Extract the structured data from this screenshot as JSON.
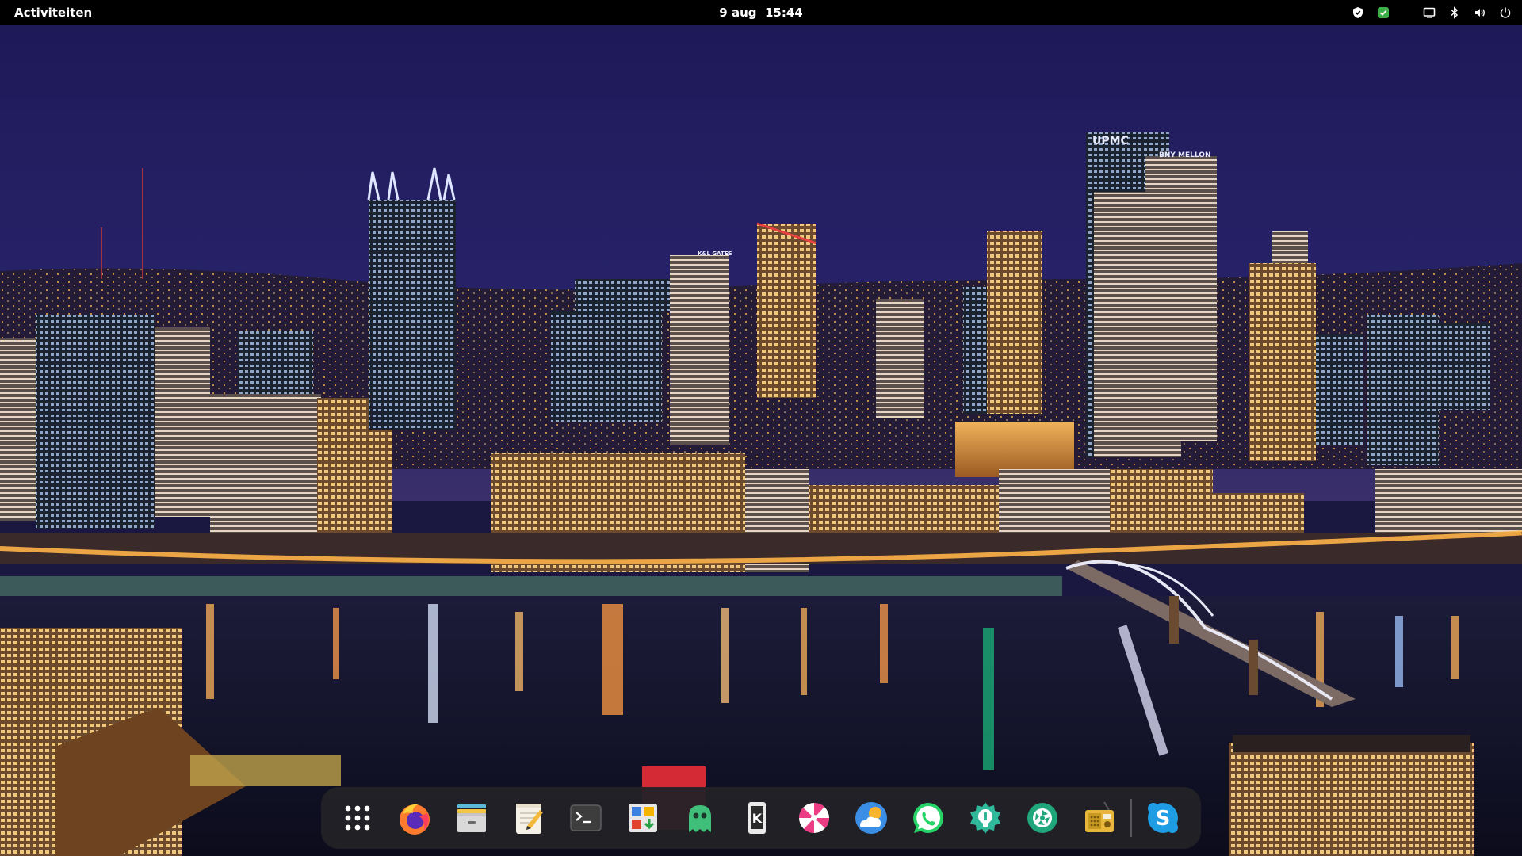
{
  "topbar": {
    "activities_label": "Activiteiten",
    "date": "9 aug",
    "time": "15:44",
    "tray_icons": [
      "shield-icon",
      "update-check-icon",
      "screen-icon",
      "bluetooth-icon",
      "volume-icon",
      "power-icon"
    ]
  },
  "wallpaper": {
    "description_icon": "city-night-skyline",
    "signs": {
      "upmc": "UPMC",
      "bny": "BNY MELLON",
      "klgates": "K&L GATES"
    }
  },
  "dock": {
    "apps": [
      {
        "name": "show-apps",
        "icon": "app-grid-icon"
      },
      {
        "name": "firefox",
        "icon": "firefox-icon"
      },
      {
        "name": "files",
        "icon": "files-icon"
      },
      {
        "name": "text-editor",
        "icon": "text-editor-icon"
      },
      {
        "name": "terminal",
        "icon": "terminal-icon"
      },
      {
        "name": "software",
        "icon": "software-store-icon"
      },
      {
        "name": "ghost-app",
        "icon": "ghost-icon"
      },
      {
        "name": "kde-connect",
        "icon": "kde-connect-icon"
      },
      {
        "name": "lollypop",
        "icon": "lollypop-icon"
      },
      {
        "name": "weather",
        "icon": "weather-icon"
      },
      {
        "name": "whatsapp",
        "icon": "whatsapp-icon"
      },
      {
        "name": "settings-app",
        "icon": "gear-bulb-icon"
      },
      {
        "name": "camera-app",
        "icon": "shutter-icon"
      },
      {
        "name": "radio-app",
        "icon": "radio-icon"
      },
      {
        "name": "skype",
        "icon": "skype-icon"
      }
    ]
  },
  "colors": {
    "topbar_bg": "#000000",
    "dock_bg": "#222226",
    "sky": "#1f1b55",
    "accent_green": "#3db146"
  }
}
